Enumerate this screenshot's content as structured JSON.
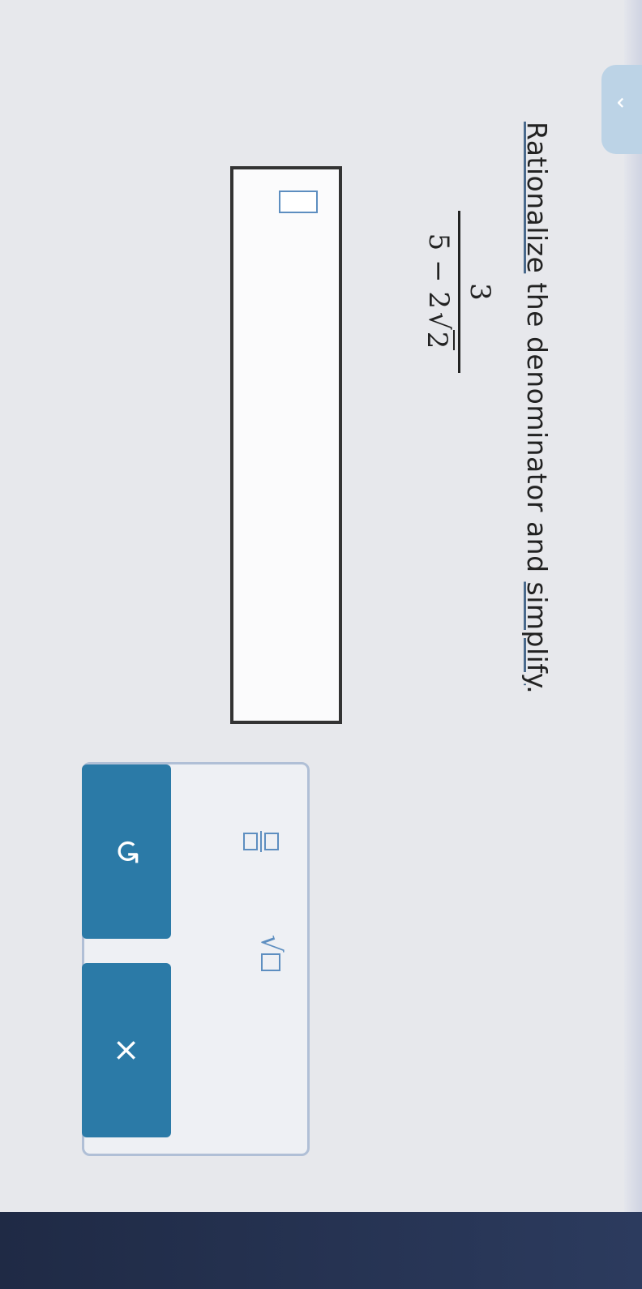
{
  "problem": {
    "prompt_word_1": "Rationalize",
    "prompt_middle": " the denominator and ",
    "prompt_word_2": "simplify",
    "prompt_end": ".",
    "numerator": "3",
    "denominator_prefix": "5 − 2",
    "radical_symbol": "√",
    "radicand": "2"
  },
  "answer": {
    "value": ""
  },
  "toolbar": {
    "undo_icon": "↺",
    "clear_icon": "×",
    "fraction_icon": "fraction-template-icon",
    "sqrt_icon": "square-root-template-icon",
    "sqrt_symbol": "√"
  },
  "colors": {
    "accent": "#2b7aa7",
    "icon_blue": "#5d8ec0",
    "header_dark": "#23304f"
  }
}
